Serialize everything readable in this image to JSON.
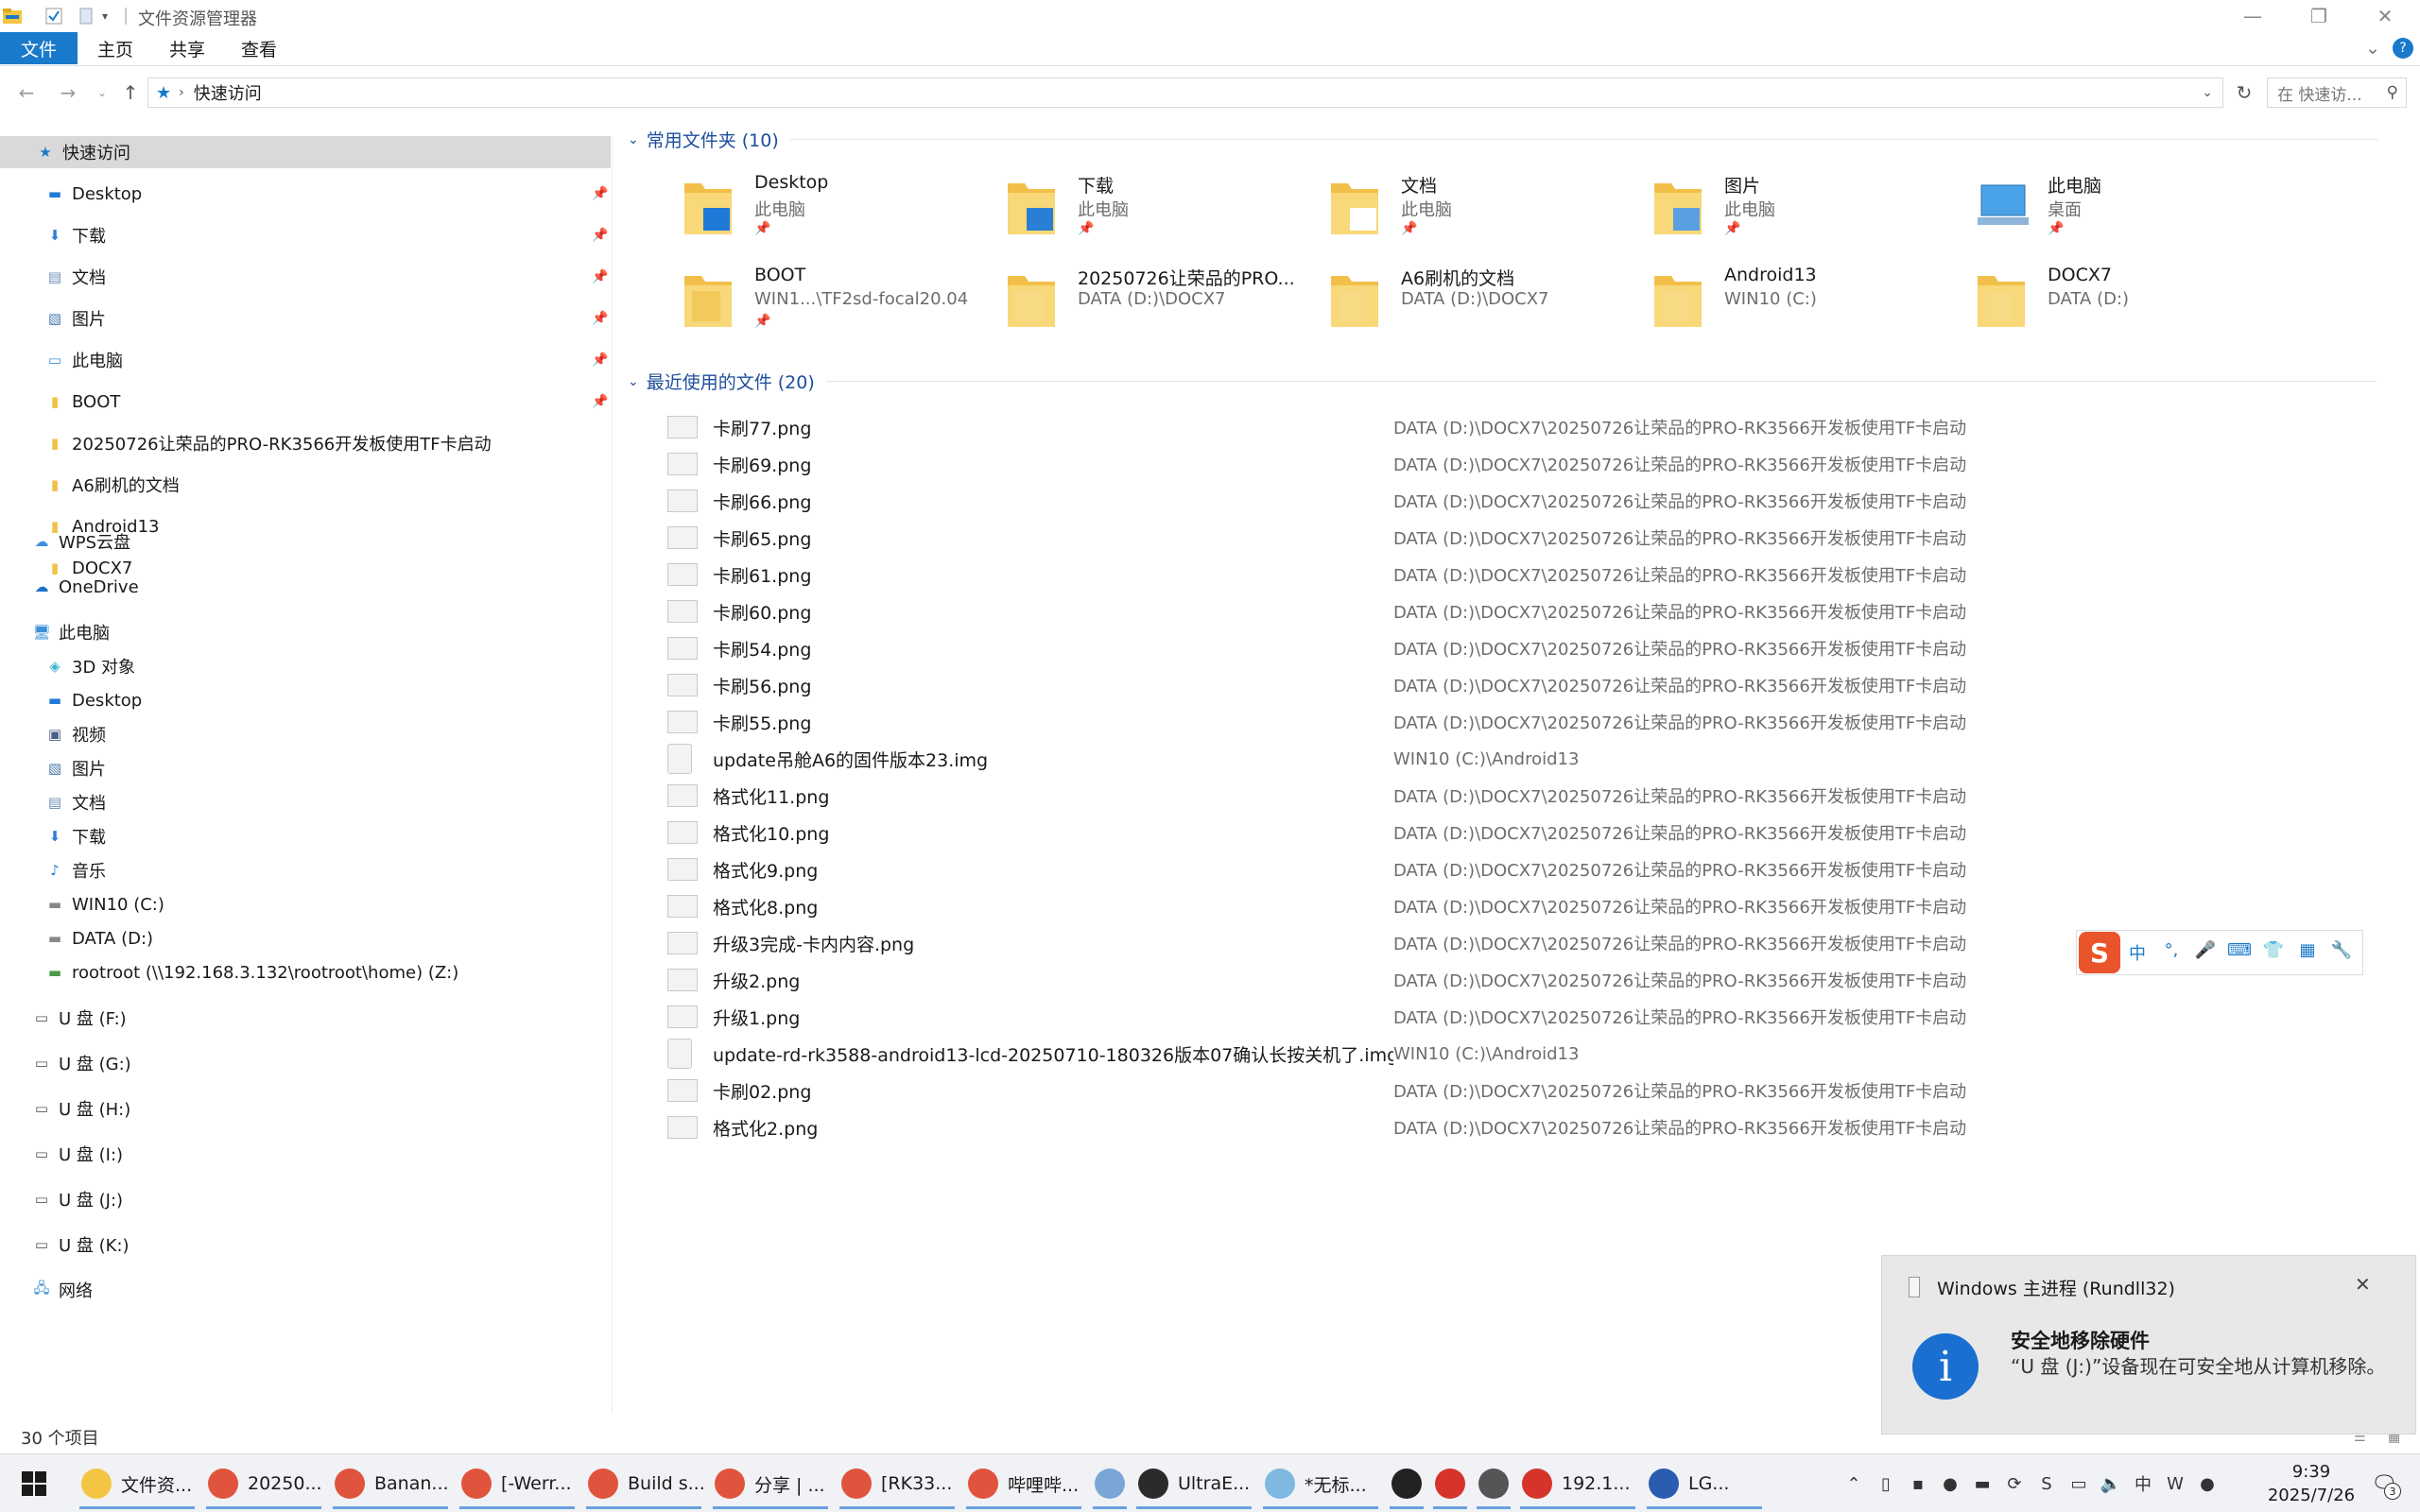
{
  "window": {
    "title": "文件资源管理器",
    "controls": {
      "minimize": "—",
      "maximize": "❐",
      "close": "✕"
    }
  },
  "ribbon": {
    "tabs": [
      "文件",
      "主页",
      "共享",
      "查看"
    ],
    "help": "?"
  },
  "address": {
    "location": "快速访问",
    "search_placeholder": "在 快速访... ",
    "search_icon": "magnifier-icon"
  },
  "nav": {
    "quick_access": "快速访问",
    "quick_items": [
      {
        "label": "Desktop",
        "icon": "desktop-icon",
        "pinned": true
      },
      {
        "label": "下载",
        "icon": "download-icon",
        "pinned": true
      },
      {
        "label": "文档",
        "icon": "document-icon",
        "pinned": true
      },
      {
        "label": "图片",
        "icon": "picture-icon",
        "pinned": true
      },
      {
        "label": "此电脑",
        "icon": "computer-icon",
        "pinned": true
      },
      {
        "label": "BOOT",
        "icon": "folder-icon",
        "pinned": true
      },
      {
        "label": "20250726让荣品的PRO-RK3566开发板使用TF卡启动",
        "icon": "folder-icon",
        "pinned": false
      },
      {
        "label": "A6刷机的文档",
        "icon": "folder-icon",
        "pinned": false
      },
      {
        "label": "Android13",
        "icon": "folder-icon",
        "pinned": false
      },
      {
        "label": "DOCX7",
        "icon": "folder-icon",
        "pinned": false
      }
    ],
    "wps": "WPS云盘",
    "onedrive": "OneDrive",
    "this_pc": "此电脑",
    "pc_items": [
      {
        "label": "3D 对象",
        "icon": "3d-objects-icon"
      },
      {
        "label": "Desktop",
        "icon": "desktop-icon"
      },
      {
        "label": "视频",
        "icon": "video-icon"
      },
      {
        "label": "图片",
        "icon": "picture-icon"
      },
      {
        "label": "文档",
        "icon": "document-icon"
      },
      {
        "label": "下载",
        "icon": "download-icon"
      },
      {
        "label": "音乐",
        "icon": "music-icon"
      },
      {
        "label": "WIN10 (C:)",
        "icon": "drive-icon"
      },
      {
        "label": "DATA (D:)",
        "icon": "drive-icon"
      },
      {
        "label": "rootroot (\\\\192.168.3.132\\rootroot\\home) (Z:)",
        "icon": "network-drive-icon"
      }
    ],
    "usb_items": [
      "U 盘 (F:)",
      "U 盘 (G:)",
      "U 盘 (H:)",
      "U 盘 (I:)",
      "U 盘 (J:)",
      "U 盘 (K:)"
    ],
    "network": "网络"
  },
  "frequent": {
    "header": "常用文件夹 (10)",
    "tiles": [
      {
        "name": "Desktop",
        "sub": "此电脑",
        "pinned": true
      },
      {
        "name": "下载",
        "sub": "此电脑",
        "pinned": true
      },
      {
        "name": "文档",
        "sub": "此电脑",
        "pinned": true
      },
      {
        "name": "图片",
        "sub": "此电脑",
        "pinned": true
      },
      {
        "name": "此电脑",
        "sub": "桌面",
        "pinned": true
      },
      {
        "name": "BOOT",
        "sub": "WIN1...\\TF2sd-focal20.04",
        "pinned": true
      },
      {
        "name": "20250726让荣品的PRO...",
        "sub": "DATA (D:)\\DOCX7",
        "pinned": false
      },
      {
        "name": "A6刷机的文档",
        "sub": "DATA (D:)\\DOCX7",
        "pinned": false
      },
      {
        "name": "Android13",
        "sub": "WIN10 (C:)",
        "pinned": false
      },
      {
        "name": "DOCX7",
        "sub": "DATA (D:)",
        "pinned": false
      }
    ]
  },
  "recent": {
    "header": "最近使用的文件 (20)",
    "files": [
      {
        "name": "卡刷77.png",
        "path": "DATA (D:)\\DOCX7\\20250726让荣品的PRO-RK3566开发板使用TF卡启动"
      },
      {
        "name": "卡刷69.png",
        "path": "DATA (D:)\\DOCX7\\20250726让荣品的PRO-RK3566开发板使用TF卡启动"
      },
      {
        "name": "卡刷66.png",
        "path": "DATA (D:)\\DOCX7\\20250726让荣品的PRO-RK3566开发板使用TF卡启动"
      },
      {
        "name": "卡刷65.png",
        "path": "DATA (D:)\\DOCX7\\20250726让荣品的PRO-RK3566开发板使用TF卡启动"
      },
      {
        "name": "卡刷61.png",
        "path": "DATA (D:)\\DOCX7\\20250726让荣品的PRO-RK3566开发板使用TF卡启动"
      },
      {
        "name": "卡刷60.png",
        "path": "DATA (D:)\\DOCX7\\20250726让荣品的PRO-RK3566开发板使用TF卡启动"
      },
      {
        "name": "卡刷54.png",
        "path": "DATA (D:)\\DOCX7\\20250726让荣品的PRO-RK3566开发板使用TF卡启动"
      },
      {
        "name": "卡刷56.png",
        "path": "DATA (D:)\\DOCX7\\20250726让荣品的PRO-RK3566开发板使用TF卡启动"
      },
      {
        "name": "卡刷55.png",
        "path": "DATA (D:)\\DOCX7\\20250726让荣品的PRO-RK3566开发板使用TF卡启动"
      },
      {
        "name": "update吊舱A6的固件版本23.img",
        "path": "WIN10 (C:)\\Android13"
      },
      {
        "name": "格式化11.png",
        "path": "DATA (D:)\\DOCX7\\20250726让荣品的PRO-RK3566开发板使用TF卡启动"
      },
      {
        "name": "格式化10.png",
        "path": "DATA (D:)\\DOCX7\\20250726让荣品的PRO-RK3566开发板使用TF卡启动"
      },
      {
        "name": "格式化9.png",
        "path": "DATA (D:)\\DOCX7\\20250726让荣品的PRO-RK3566开发板使用TF卡启动"
      },
      {
        "name": "格式化8.png",
        "path": "DATA (D:)\\DOCX7\\20250726让荣品的PRO-RK3566开发板使用TF卡启动"
      },
      {
        "name": "升级3完成-卡内内容.png",
        "path": "DATA (D:)\\DOCX7\\20250726让荣品的PRO-RK3566开发板使用TF卡启动"
      },
      {
        "name": "升级2.png",
        "path": "DATA (D:)\\DOCX7\\20250726让荣品的PRO-RK3566开发板使用TF卡启动"
      },
      {
        "name": "升级1.png",
        "path": "DATA (D:)\\DOCX7\\20250726让荣品的PRO-RK3566开发板使用TF卡启动"
      },
      {
        "name": "update-rd-rk3588-android13-lcd-20250710-180326版本07确认长按关机了.img",
        "path": "WIN10 (C:)\\Android13"
      },
      {
        "name": "卡刷02.png",
        "path": "DATA (D:)\\DOCX7\\20250726让荣品的PRO-RK3566开发板使用TF卡启动"
      },
      {
        "name": "格式化2.png",
        "path": "DATA (D:)\\DOCX7\\20250726让荣品的PRO-RK3566开发板使用TF卡启动"
      }
    ]
  },
  "status": {
    "count": "30 个项目"
  },
  "toast": {
    "app": "Windows 主进程 (Rundll32)",
    "title": "安全地移除硬件",
    "body": "“U 盘 (J:)”设备现在可安全地从计算机移除。",
    "close": "✕",
    "icon_text": "i"
  },
  "ime": {
    "logo": "S",
    "items": [
      "中",
      "°,",
      "🎤",
      "⌨",
      "👕",
      "▦",
      "🔧"
    ]
  },
  "taskbar": {
    "apps": [
      {
        "label": "文件资...",
        "icon": "explorer-icon",
        "color": "#f4c542"
      },
      {
        "label": "20250...",
        "icon": "chrome-icon",
        "color": "#e0533d"
      },
      {
        "label": "Banan...",
        "icon": "chrome-icon",
        "color": "#e0533d"
      },
      {
        "label": "[-Werr...",
        "icon": "chrome-icon",
        "color": "#e0533d"
      },
      {
        "label": "Build s...",
        "icon": "chrome-icon",
        "color": "#e0533d"
      },
      {
        "label": "分享 | ...",
        "icon": "chrome-icon",
        "color": "#e0533d"
      },
      {
        "label": "[RK33...",
        "icon": "chrome-icon",
        "color": "#e0533d"
      },
      {
        "label": "哔哩哔...",
        "icon": "chrome-icon",
        "color": "#e0533d"
      },
      {
        "label": "",
        "icon": "paint-icon",
        "color": "#7aa6d6"
      },
      {
        "label": "UltraE...",
        "icon": "ultraedit-icon",
        "color": "#2b2b2b"
      },
      {
        "label": "*无标...",
        "icon": "notepad-icon",
        "color": "#7fb8e0"
      },
      {
        "label": "",
        "icon": "terminal-icon",
        "color": "#222222"
      },
      {
        "label": "",
        "icon": "wps-icon",
        "color": "#d6342b"
      },
      {
        "label": "",
        "icon": "app-icon",
        "color": "#555555"
      },
      {
        "label": "192.1...",
        "icon": "xshell-icon",
        "color": "#d6342b"
      },
      {
        "label": "LG...",
        "icon": "lg-icon",
        "color": "#2a5db0"
      }
    ],
    "time": "9:39",
    "date": "2025/7/26",
    "notification_count": "3",
    "tray_icons": [
      "chevron-up-icon",
      "usb-icon",
      "app-icon",
      "wechat-icon",
      "battery-icon",
      "sync-icon",
      "sogou-icon",
      "network-icon",
      "volume-icon",
      "ime-icon",
      "wps-tray-icon",
      "green-icon"
    ]
  }
}
